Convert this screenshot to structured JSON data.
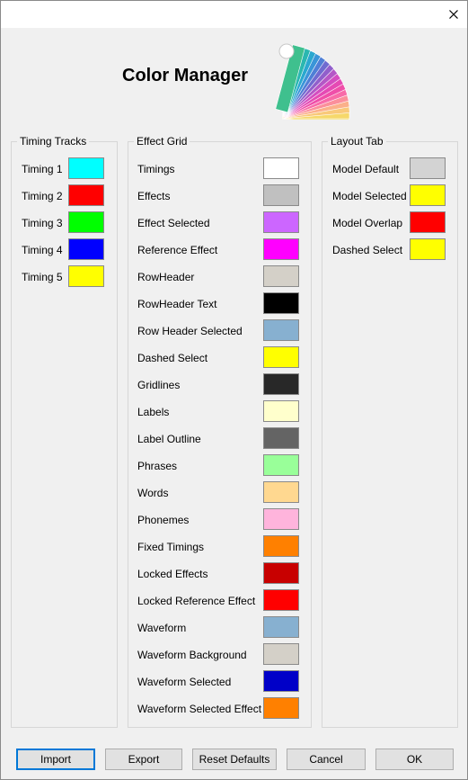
{
  "window": {
    "title": "Color Manager"
  },
  "timing_tracks": {
    "title": "Timing Tracks",
    "items": [
      {
        "label": "Timing 1",
        "color": "#00ffff"
      },
      {
        "label": "Timing 2",
        "color": "#ff0000"
      },
      {
        "label": "Timing 3",
        "color": "#00ff00"
      },
      {
        "label": "Timing 4",
        "color": "#0000ff"
      },
      {
        "label": "Timing 5",
        "color": "#ffff00"
      }
    ]
  },
  "effect_grid": {
    "title": "Effect Grid",
    "items": [
      {
        "label": "Timings",
        "color": "#ffffff"
      },
      {
        "label": "Effects",
        "color": "#c0c0c0"
      },
      {
        "label": "Effect Selected",
        "color": "#cc66ff"
      },
      {
        "label": "Reference Effect",
        "color": "#ff00ff"
      },
      {
        "label": "RowHeader",
        "color": "#d4d0c8"
      },
      {
        "label": "RowHeader Text",
        "color": "#000000"
      },
      {
        "label": "Row Header Selected",
        "color": "#87b0d0"
      },
      {
        "label": "Dashed Select",
        "color": "#ffff00"
      },
      {
        "label": "Gridlines",
        "color": "#282828"
      },
      {
        "label": "Labels",
        "color": "#ffffcc"
      },
      {
        "label": "Label Outline",
        "color": "#646464"
      },
      {
        "label": "Phrases",
        "color": "#99ff99"
      },
      {
        "label": "Words",
        "color": "#ffd890"
      },
      {
        "label": "Phonemes",
        "color": "#ffb4dc"
      },
      {
        "label": "Fixed Timings",
        "color": "#ff8000"
      },
      {
        "label": "Locked Effects",
        "color": "#c80000"
      },
      {
        "label": "Locked Reference Effect",
        "color": "#ff0000"
      },
      {
        "label": "Waveform",
        "color": "#87b0d0"
      },
      {
        "label": "Waveform Background",
        "color": "#d4d0c8"
      },
      {
        "label": "Waveform Selected",
        "color": "#0000c8"
      },
      {
        "label": "Waveform Selected Effect",
        "color": "#ff8000"
      }
    ]
  },
  "layout_tab": {
    "title": "Layout Tab",
    "items": [
      {
        "label": "Model Default",
        "color": "#d3d3d3"
      },
      {
        "label": "Model Selected",
        "color": "#ffff00"
      },
      {
        "label": "Model Overlap",
        "color": "#ff0000"
      },
      {
        "label": "Dashed Select",
        "color": "#ffff00"
      }
    ]
  },
  "buttons": {
    "import": "Import",
    "export": "Export",
    "reset": "Reset Defaults",
    "cancel": "Cancel",
    "ok": "OK"
  }
}
